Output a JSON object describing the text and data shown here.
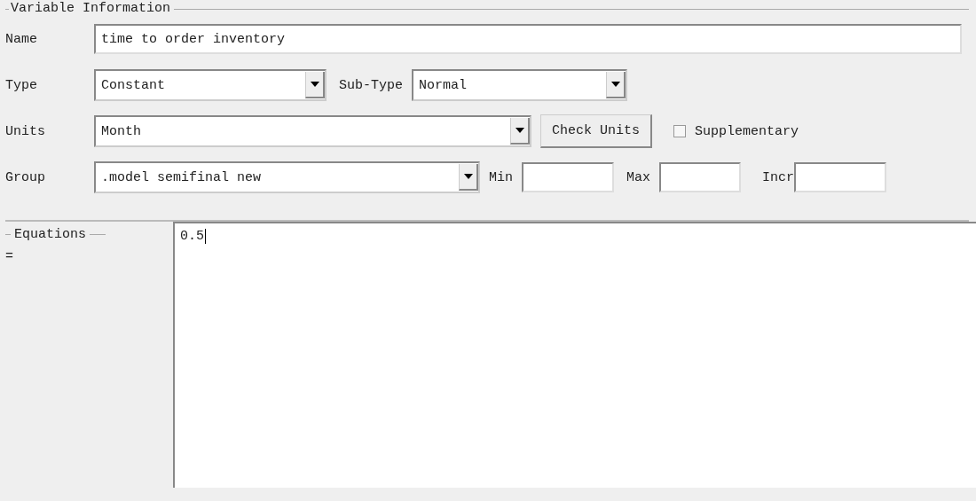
{
  "variable_information": {
    "title": "Variable Information",
    "name": {
      "label": "Name",
      "value": "time to order inventory"
    },
    "type": {
      "label": "Type",
      "value": "Constant"
    },
    "sub_type": {
      "label": "Sub-Type",
      "value": "Normal"
    },
    "units": {
      "label": "Units",
      "value": "Month"
    },
    "check_units_button": "Check Units",
    "supplementary": {
      "label": "Supplementary",
      "checked": false
    },
    "group": {
      "label": "Group",
      "value": ".model semifinal new"
    },
    "min": {
      "label": "Min"
    },
    "max": {
      "label": "Max"
    },
    "incr": {
      "label": "Incr"
    }
  },
  "equations": {
    "title": "Equations",
    "sign": "=",
    "value": "0.5"
  }
}
